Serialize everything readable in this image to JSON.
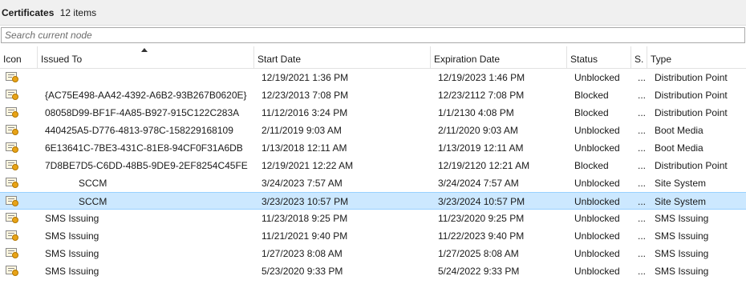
{
  "header": {
    "title": "Certificates",
    "count_label": "12 items"
  },
  "search": {
    "placeholder": "Search current node",
    "value": ""
  },
  "columns": {
    "icon": "Icon",
    "issued_to": "Issued To",
    "start_date": "Start Date",
    "expiration_date": "Expiration Date",
    "status": "Status",
    "s": "S.",
    "type": "Type"
  },
  "rows": [
    {
      "issued_to": "",
      "start": "12/19/2021 1:36 PM",
      "exp": "12/19/2023 1:46 PM",
      "status": "Unblocked",
      "s": "...",
      "type": "Distribution Point",
      "indent": false
    },
    {
      "issued_to": "{AC75E498-AA42-4392-A6B2-93B267B0620E}",
      "start": "12/23/2013 7:08 PM",
      "exp": "12/23/2112 7:08 PM",
      "status": "Blocked",
      "s": "...",
      "type": "Distribution Point",
      "indent": false
    },
    {
      "issued_to": "08058D99-BF1F-4A85-B927-915C122C283A",
      "start": "11/12/2016 3:24 PM",
      "exp": "1/1/2130 4:08 PM",
      "status": "Blocked",
      "s": "...",
      "type": "Distribution Point",
      "indent": false
    },
    {
      "issued_to": "440425A5-D776-4813-978C-158229168109",
      "start": "2/11/2019 9:03 AM",
      "exp": "2/11/2020 9:03 AM",
      "status": "Unblocked",
      "s": "...",
      "type": "Boot Media",
      "indent": false
    },
    {
      "issued_to": "6E13641C-7BE3-431C-81E8-94CF0F31A6DB",
      "start": "1/13/2018 12:11 AM",
      "exp": "1/13/2019 12:11 AM",
      "status": "Unblocked",
      "s": "...",
      "type": "Boot Media",
      "indent": false
    },
    {
      "issued_to": "7D8BE7D5-C6DD-48B5-9DE9-2EF8254C45FE",
      "start": "12/19/2021 12:22 AM",
      "exp": "12/19/2120 12:21 AM",
      "status": "Blocked",
      "s": "...",
      "type": "Distribution Point",
      "indent": false
    },
    {
      "issued_to": "SCCM",
      "start": "3/24/2023 7:57 AM",
      "exp": "3/24/2024 7:57 AM",
      "status": "Unblocked",
      "s": "...",
      "type": "Site System",
      "indent": true
    },
    {
      "issued_to": "SCCM",
      "start": "3/23/2023 10:57 PM",
      "exp": "3/23/2024 10:57 PM",
      "status": "Unblocked",
      "s": "...",
      "type": "Site System",
      "indent": true,
      "selected": true
    },
    {
      "issued_to": "SMS Issuing",
      "start": "11/23/2018 9:25 PM",
      "exp": "11/23/2020 9:25 PM",
      "status": "Unblocked",
      "s": "...",
      "type": "SMS Issuing",
      "indent": false
    },
    {
      "issued_to": "SMS Issuing",
      "start": "11/21/2021 9:40 PM",
      "exp": "11/22/2023 9:40 PM",
      "status": "Unblocked",
      "s": "...",
      "type": "SMS Issuing",
      "indent": false
    },
    {
      "issued_to": "SMS Issuing",
      "start": "1/27/2023 8:08 AM",
      "exp": "1/27/2025 8:08 AM",
      "status": "Unblocked",
      "s": "...",
      "type": "SMS Issuing",
      "indent": false
    },
    {
      "issued_to": "SMS Issuing",
      "start": "5/23/2020 9:33 PM",
      "exp": "5/24/2022 9:33 PM",
      "status": "Unblocked",
      "s": "...",
      "type": "SMS Issuing",
      "indent": false
    }
  ],
  "icon_name": "certificate-icon",
  "colors": {
    "selection": "#cce8ff",
    "selection_border": "#99d1ff",
    "header_bg": "#f0f0f0"
  }
}
